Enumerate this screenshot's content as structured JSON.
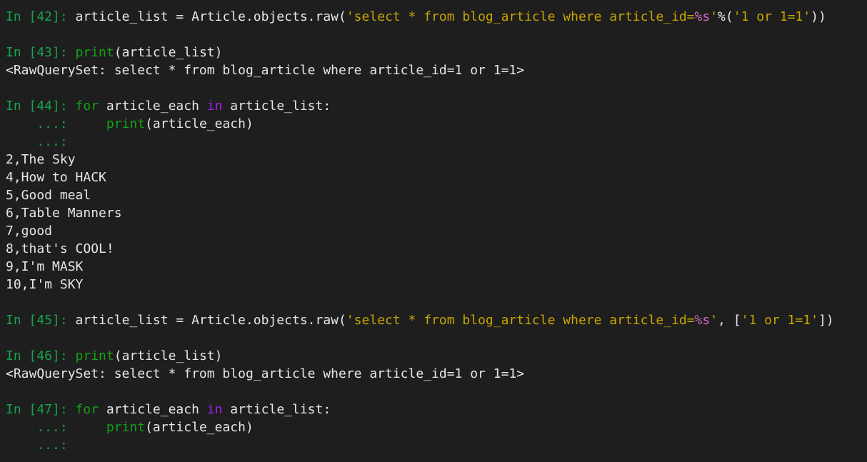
{
  "colors": {
    "background": "#1e1e1e",
    "prompt": "#16a34a",
    "string": "#c7a500",
    "format_spec": "#d36ac2",
    "keyword_green": "#15a215",
    "keyword_purple": "#a020f0",
    "text": "#e6e6e6"
  },
  "lines": [
    {
      "type": "input",
      "prompt": "In [42]: ",
      "code": [
        {
          "t": "article_list = Article.objects.raw(",
          "c": "plain"
        },
        {
          "t": "'select * from blog_article where article_id=",
          "c": "str"
        },
        {
          "t": "%s",
          "c": "fmt"
        },
        {
          "t": "'",
          "c": "str"
        },
        {
          "t": "%(",
          "c": "plain"
        },
        {
          "t": "'1 or 1=1'",
          "c": "str"
        },
        {
          "t": "))",
          "c": "plain"
        }
      ]
    },
    {
      "type": "blank"
    },
    {
      "type": "input",
      "prompt": "In [43]: ",
      "code": [
        {
          "t": "print",
          "c": "builtin"
        },
        {
          "t": "(article_list)",
          "c": "plain"
        }
      ]
    },
    {
      "type": "output",
      "text": "<RawQuerySet: select * from blog_article where article_id=1 or 1=1>"
    },
    {
      "type": "blank"
    },
    {
      "type": "input",
      "prompt": "In [44]: ",
      "code": [
        {
          "t": "for",
          "c": "kw"
        },
        {
          "t": " article_each ",
          "c": "plain"
        },
        {
          "t": "in",
          "c": "kw2"
        },
        {
          "t": " article_list:",
          "c": "plain"
        }
      ]
    },
    {
      "type": "cont",
      "prompt": "    ...: ",
      "code": [
        {
          "t": "    ",
          "c": "plain"
        },
        {
          "t": "print",
          "c": "builtin"
        },
        {
          "t": "(article_each)",
          "c": "plain"
        }
      ]
    },
    {
      "type": "cont",
      "prompt": "    ...:",
      "code": []
    },
    {
      "type": "output",
      "text": "2,The Sky"
    },
    {
      "type": "output",
      "text": "4,How to HACK"
    },
    {
      "type": "output",
      "text": "5,Good meal"
    },
    {
      "type": "output",
      "text": "6,Table Manners"
    },
    {
      "type": "output",
      "text": "7,good"
    },
    {
      "type": "output",
      "text": "8,that's COOL!"
    },
    {
      "type": "output",
      "text": "9,I'm MASK"
    },
    {
      "type": "output",
      "text": "10,I'm SKY"
    },
    {
      "type": "blank"
    },
    {
      "type": "input",
      "prompt": "In [45]: ",
      "code": [
        {
          "t": "article_list = Article.objects.raw(",
          "c": "plain"
        },
        {
          "t": "'select * from blog_article where article_id=",
          "c": "str"
        },
        {
          "t": "%s",
          "c": "fmt"
        },
        {
          "t": "'",
          "c": "str"
        },
        {
          "t": ", [",
          "c": "plain"
        },
        {
          "t": "'1 or 1=1'",
          "c": "str"
        },
        {
          "t": "])",
          "c": "plain"
        }
      ]
    },
    {
      "type": "blank"
    },
    {
      "type": "input",
      "prompt": "In [46]: ",
      "code": [
        {
          "t": "print",
          "c": "builtin"
        },
        {
          "t": "(article_list)",
          "c": "plain"
        }
      ]
    },
    {
      "type": "output",
      "text": "<RawQuerySet: select * from blog_article where article_id=1 or 1=1>"
    },
    {
      "type": "blank"
    },
    {
      "type": "input",
      "prompt": "In [47]: ",
      "code": [
        {
          "t": "for",
          "c": "kw"
        },
        {
          "t": " article_each ",
          "c": "plain"
        },
        {
          "t": "in",
          "c": "kw2"
        },
        {
          "t": " article_list:",
          "c": "plain"
        }
      ]
    },
    {
      "type": "cont",
      "prompt": "    ...: ",
      "code": [
        {
          "t": "    ",
          "c": "plain"
        },
        {
          "t": "print",
          "c": "builtin"
        },
        {
          "t": "(article_each)",
          "c": "plain"
        }
      ]
    },
    {
      "type": "cont",
      "prompt": "    ...:",
      "code": []
    }
  ]
}
